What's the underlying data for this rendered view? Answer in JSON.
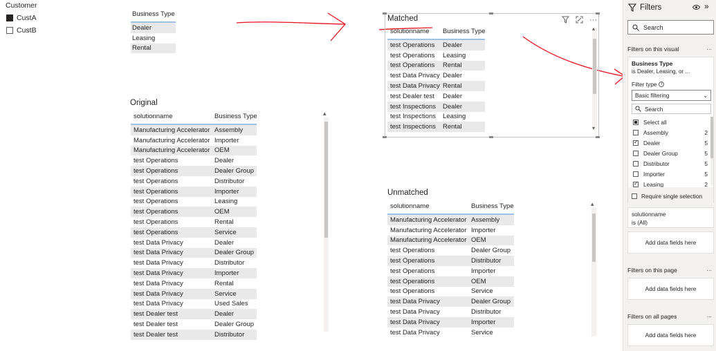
{
  "customer_slicer": {
    "title": "Customer",
    "items": [
      {
        "label": "CustA",
        "selected": true
      },
      {
        "label": "CustB",
        "selected": false
      }
    ]
  },
  "business_type_table": {
    "header": "Business Type",
    "rows": [
      "Dealer",
      "Leasing",
      "Rental"
    ]
  },
  "original": {
    "title": "Original",
    "headers": [
      "solutionname",
      "Business Type"
    ],
    "rows": [
      [
        "Manufacturing Accelerator",
        "Assembly"
      ],
      [
        "Manufacturing Accelerator",
        "Importer"
      ],
      [
        "Manufacturing Accelerator",
        "OEM"
      ],
      [
        "test Operations",
        "Dealer"
      ],
      [
        "test Operations",
        "Dealer Group"
      ],
      [
        "test Operations",
        "Distributor"
      ],
      [
        "test Operations",
        "Importer"
      ],
      [
        "test Operations",
        "Leasing"
      ],
      [
        "test Operations",
        "OEM"
      ],
      [
        "test Operations",
        "Rental"
      ],
      [
        "test Operations",
        "Service"
      ],
      [
        "test Data Privacy",
        "Dealer"
      ],
      [
        "test Data Privacy",
        "Dealer Group"
      ],
      [
        "test Data Privacy",
        "Distributor"
      ],
      [
        "test Data Privacy",
        "Importer"
      ],
      [
        "test Data Privacy",
        "Rental"
      ],
      [
        "test Data Privacy",
        "Service"
      ],
      [
        "test Data Privacy",
        "Used Sales"
      ],
      [
        "test Dealer test",
        "Dealer"
      ],
      [
        "test Dealer test",
        "Dealer Group"
      ],
      [
        "test Dealer test",
        "Distributor"
      ]
    ]
  },
  "matched": {
    "title": "Matched",
    "headers": [
      "solutionname",
      "Business Type"
    ],
    "rows": [
      [
        "test Operations",
        "Dealer"
      ],
      [
        "test Operations",
        "Leasing"
      ],
      [
        "test Operations",
        "Rental"
      ],
      [
        "test Data Privacy",
        "Dealer"
      ],
      [
        "test Data Privacy",
        "Rental"
      ],
      [
        "test Dealer test",
        "Dealer"
      ],
      [
        "test Inspections",
        "Dealer"
      ],
      [
        "test Inspections",
        "Leasing"
      ],
      [
        "test Inspections",
        "Rental"
      ]
    ],
    "icons": [
      "filter-icon",
      "focus-mode-icon",
      "more-options-icon"
    ]
  },
  "unmatched": {
    "title": "Unmatched",
    "headers": [
      "solutionname",
      "Business Type"
    ],
    "rows": [
      [
        "Manufacturing Accelerator",
        "Assembly"
      ],
      [
        "Manufacturing Accelerator",
        "Importer"
      ],
      [
        "Manufacturing Accelerator",
        "OEM"
      ],
      [
        "test Operations",
        "Dealer Group"
      ],
      [
        "test Operations",
        "Distributor"
      ],
      [
        "test Operations",
        "Importer"
      ],
      [
        "test Operations",
        "OEM"
      ],
      [
        "test Operations",
        "Service"
      ],
      [
        "test Data Privacy",
        "Dealer Group"
      ],
      [
        "test Data Privacy",
        "Distributor"
      ],
      [
        "test Data Privacy",
        "Importer"
      ],
      [
        "test Data Privacy",
        "Service"
      ]
    ]
  },
  "filters_pane": {
    "title": "Filters",
    "search_placeholder": "Search",
    "on_visual_label": "Filters on this visual",
    "business_type_card": {
      "title": "Business Type",
      "summary": "is Dealer, Leasing, or ...",
      "filter_type_label": "Filter type",
      "filter_type_value": "Basic filtering",
      "search_placeholder": "Search",
      "items": [
        {
          "label": "Select all",
          "count": "",
          "state": "partial"
        },
        {
          "label": "Assembly",
          "count": "2",
          "state": "unchecked"
        },
        {
          "label": "Dealer",
          "count": "5",
          "state": "checked"
        },
        {
          "label": "Dealer Group",
          "count": "5",
          "state": "unchecked"
        },
        {
          "label": "Distributor",
          "count": "5",
          "state": "unchecked"
        },
        {
          "label": "Importer",
          "count": "5",
          "state": "unchecked"
        },
        {
          "label": "Leasing",
          "count": "2",
          "state": "checked"
        }
      ],
      "require_single": "Require single selection"
    },
    "solutionname_card": {
      "title": "solutionname",
      "summary": "is (All)"
    },
    "add_data_fields": "Add data fields here",
    "on_page_label": "Filters on this page",
    "on_all_pages_label": "Filters on all pages",
    "more": "..."
  },
  "colors": {
    "accent_line": "#9cc3e6",
    "row_alt": "#e9e9e9",
    "annotation": "#e8121b",
    "pane_bg": "#f3f2f1"
  }
}
